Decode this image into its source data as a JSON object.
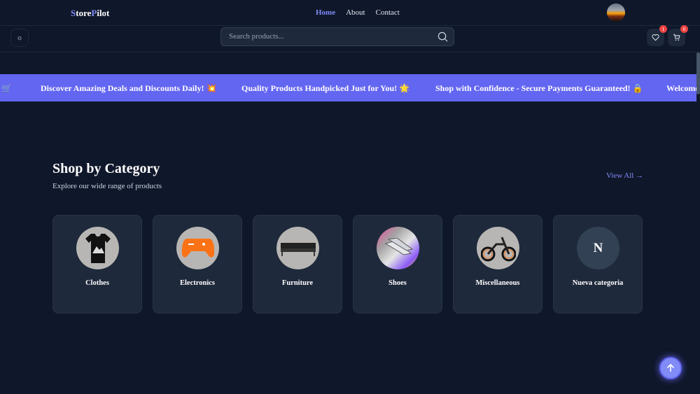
{
  "header": {
    "logo_first": "S",
    "logo_mid": "tore",
    "logo_p": "P",
    "logo_rest": "ilot",
    "nav": [
      "Home",
      "About",
      "Contact"
    ]
  },
  "toolbar": {
    "theme_icon": "☼",
    "search_placeholder": "Search products...",
    "wishlist_count": "1",
    "cart_count": "0"
  },
  "banner": {
    "items": [
      "🛒",
      "Discover Amazing Deals and Discounts Daily! 💥",
      "Quality Products Handpicked Just for You! 🌟",
      "Shop with Confidence - Secure Payments Guaranteed! 🔒",
      "Welcome"
    ]
  },
  "section": {
    "title": "Shop by Category",
    "subtitle": "Explore our wide range of products",
    "view_all": "View All",
    "view_all_arrow": "→"
  },
  "categories": [
    {
      "name": "Clothes"
    },
    {
      "name": "Electronics"
    },
    {
      "name": "Furniture"
    },
    {
      "name": "Shoes"
    },
    {
      "name": "Miscellaneous"
    },
    {
      "name": "Nueva categoria",
      "initial": "N"
    }
  ],
  "colors": {
    "bg": "#0f172a",
    "card": "#1e293b",
    "accent": "#6366f1",
    "link": "#818cf8",
    "badge": "#ef4444"
  }
}
